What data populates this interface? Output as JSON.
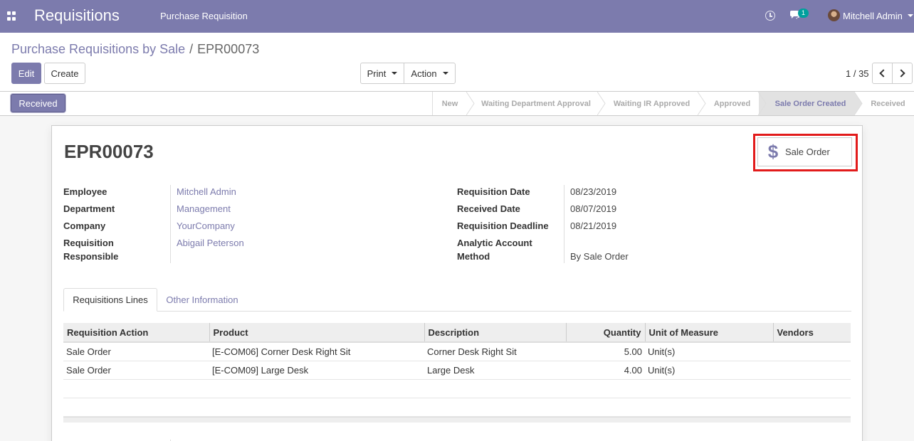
{
  "navbar": {
    "brand": "Requisitions",
    "menu_item": "Purchase Requisition",
    "chat_badge": "1",
    "user_name": "Mitchell Admin"
  },
  "control_panel": {
    "breadcrumb_parent": "Purchase Requisitions by Sale",
    "breadcrumb_separator": "/",
    "breadcrumb_current": "EPR00073",
    "edit_label": "Edit",
    "create_label": "Create",
    "print_label": "Print",
    "action_label": "Action",
    "pager": "1 / 35"
  },
  "statusbar": {
    "button_label": "Received",
    "stages": [
      {
        "label": "New",
        "active": false
      },
      {
        "label": "Waiting Department Approval",
        "active": false
      },
      {
        "label": "Waiting IR Approved",
        "active": false
      },
      {
        "label": "Approved",
        "active": false
      },
      {
        "label": "Sale Order Created",
        "active": true
      },
      {
        "label": "Received",
        "active": false
      }
    ]
  },
  "form": {
    "record_name": "EPR00073",
    "smart_button_label": "Sale Order",
    "left_fields": [
      {
        "label": "Employee",
        "value": "Mitchell Admin"
      },
      {
        "label": "Department",
        "value": "Management"
      },
      {
        "label": "Company",
        "value": "YourCompany"
      },
      {
        "label": "Requisition Responsible",
        "value": "Abigail Peterson"
      }
    ],
    "right_fields": [
      {
        "label": "Requisition Date",
        "value": "08/23/2019"
      },
      {
        "label": "Received Date",
        "value": "08/07/2019"
      },
      {
        "label": "Requisition Deadline",
        "value": "08/21/2019"
      },
      {
        "label": "Analytic Account Method",
        "value": "By Sale Order"
      }
    ],
    "tabs": [
      "Requisitions Lines",
      "Other Information"
    ],
    "table": {
      "columns": [
        "Requisition Action",
        "Product",
        "Description",
        "Quantity",
        "Unit of Measure",
        "Vendors"
      ],
      "rows": [
        [
          "Sale Order",
          "[E-COM06] Corner Desk Right Sit",
          "Corner Desk Right Sit",
          "5.00",
          "Unit(s)",
          ""
        ],
        [
          "Sale Order",
          "[E-COM09] Large Desk",
          "Large Desk",
          "4.00",
          "Unit(s)",
          ""
        ]
      ]
    }
  },
  "colors": {
    "brand": "#7c7bad",
    "highlight": "#e21b1b"
  }
}
